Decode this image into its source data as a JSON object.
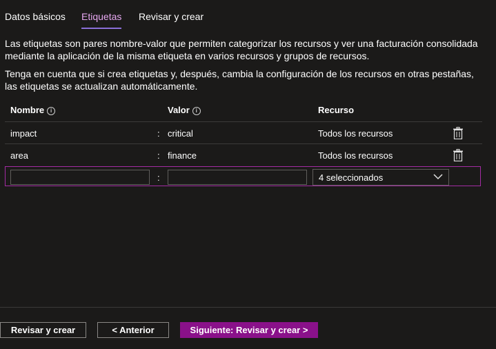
{
  "tabs": [
    {
      "label": "Datos básicos",
      "active": false
    },
    {
      "label": "Etiquetas",
      "active": true
    },
    {
      "label": "Revisar y crear",
      "active": false
    }
  ],
  "description": {
    "para1": "Las etiquetas son pares nombre-valor que permiten categorizar los recursos y ver una facturación consolidada mediante la aplicación de la misma etiqueta en varios recursos y grupos de recursos.",
    "para2": "Tenga en cuenta que si crea etiquetas y, después, cambia la configuración de los recursos en otras pestañas, las etiquetas se actualizan automáticamente."
  },
  "table": {
    "headers": {
      "name": "Nombre",
      "value": "Valor",
      "resource": "Recurso"
    },
    "info_icon": "info-icon",
    "separator": ":",
    "rows": [
      {
        "name": "impact",
        "value": "critical",
        "resource": "Todos los recursos"
      },
      {
        "name": "area",
        "value": "finance",
        "resource": "Todos los recursos"
      }
    ],
    "new_row": {
      "name_value": "",
      "value_value": "",
      "resource_selected": "4 seleccionados"
    }
  },
  "footer": {
    "review_create": "Revisar y crear",
    "previous": "< Anterior",
    "next": "Siguiente: Revisar y crear >"
  },
  "colors": {
    "background": "#1b1a19",
    "active_tab": "#e6a8f0",
    "tab_underline": "#8a6fd8",
    "accent": "#8a118a",
    "new_row_border": "#a42ba4"
  }
}
